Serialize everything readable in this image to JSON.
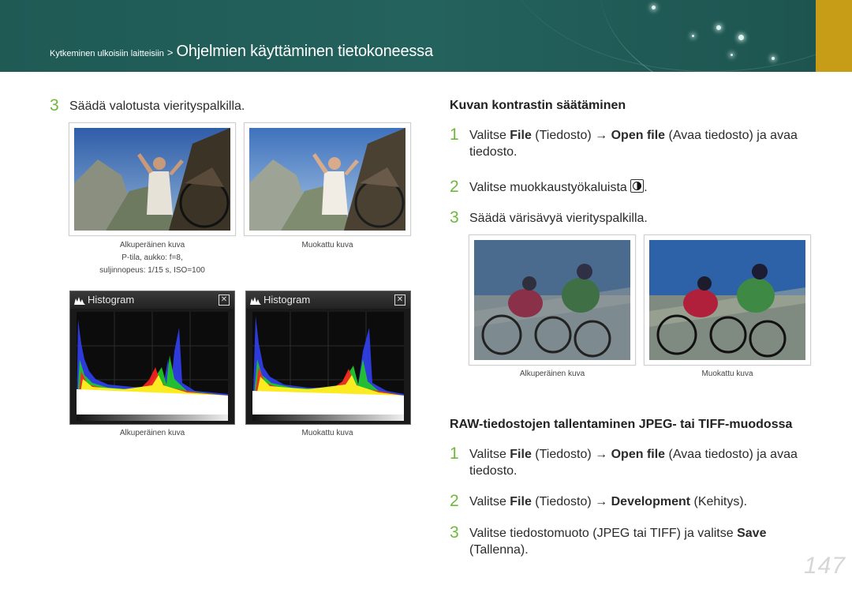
{
  "header": {
    "breadcrumb_small": "Kytkeminen ulkoisiin laitteisiin",
    "separator": ">",
    "breadcrumb_title": "Ohjelmien käyttäminen tietokoneessa"
  },
  "left": {
    "step3": {
      "num": "3",
      "text": "Säädä valotusta vierityspalkilla."
    },
    "photo_captions": {
      "original": "Alkuperäinen kuva",
      "original_line2": "P-tila, aukko: f=8,",
      "original_line3": "suljinnopeus: 1/15 s, ISO=100",
      "modified": "Muokattu kuva"
    },
    "histogram_title": "Histogram",
    "histogram_captions": {
      "original": "Alkuperäinen kuva",
      "modified": "Muokattu kuva"
    }
  },
  "contrast": {
    "heading": "Kuvan kontrastin säätäminen",
    "step1": {
      "num": "1",
      "pre": "Valitse ",
      "k1": "File",
      "m1": " (Tiedosto) → ",
      "k2": "Open file",
      "post": " (Avaa tiedosto) ja avaa",
      "line2": "tiedosto."
    },
    "step2": {
      "num": "2",
      "text": "Valitse muokkaustyökaluista",
      "end": "."
    },
    "step3": {
      "num": "3",
      "text": "Säädä värisävyä vierityspalkilla."
    },
    "captions": {
      "original": "Alkuperäinen kuva",
      "modified": "Muokattu kuva"
    }
  },
  "raw": {
    "heading": "RAW-tiedostojen tallentaminen JPEG- tai TIFF-muodossa",
    "step1": {
      "num": "1",
      "pre": "Valitse ",
      "k1": "File",
      "m1": " (Tiedosto) → ",
      "k2": "Open file",
      "post": " (Avaa tiedosto) ja avaa",
      "line2": "tiedosto."
    },
    "step2": {
      "num": "2",
      "pre": "Valitse ",
      "k1": "File",
      "m1": " (Tiedosto) → ",
      "k2": "Development",
      "post": " (Kehitys)."
    },
    "step3": {
      "num": "3",
      "pre": "Valitse tiedostomuoto (JPEG tai TIFF) ja valitse ",
      "k1": "Save",
      "line2": "(Tallenna)."
    }
  },
  "page_number": "147",
  "colors": {
    "header_bg": "#22605b",
    "accent_gold": "#c79c16",
    "step_number": "#6fb83a"
  }
}
